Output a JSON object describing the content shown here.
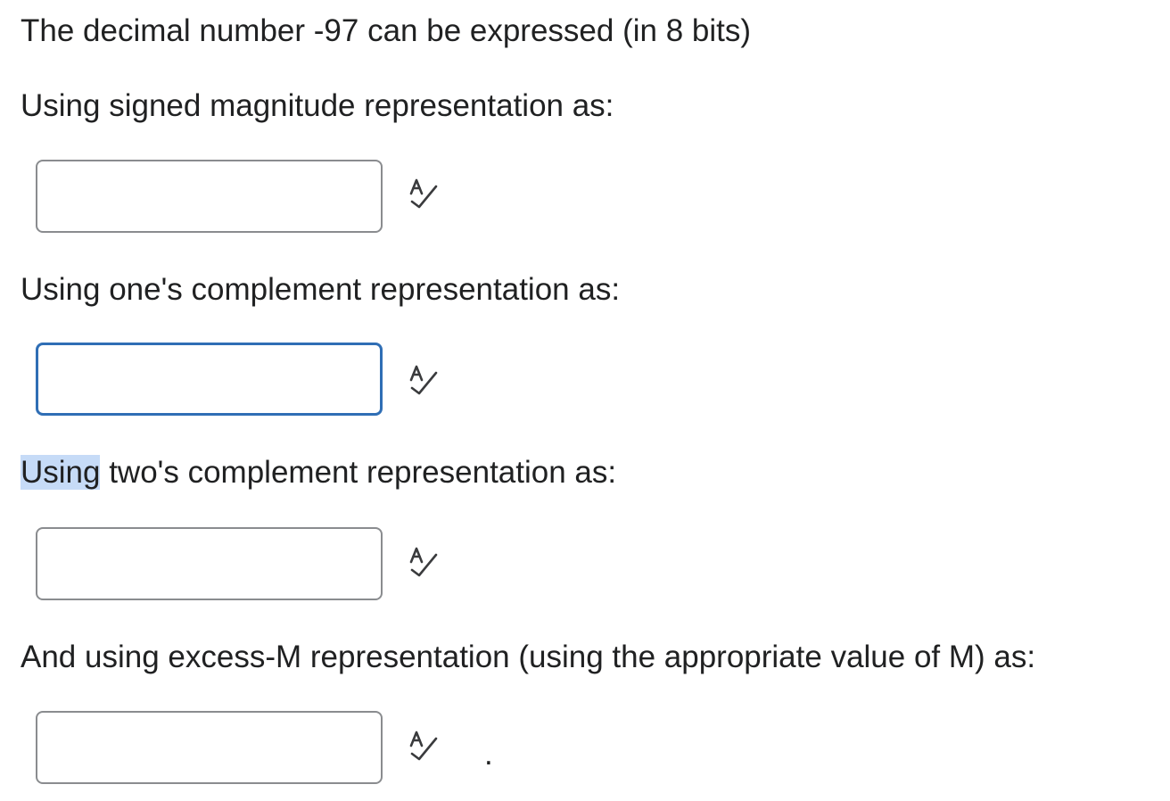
{
  "question": {
    "intro": "The decimal number -97 can be expressed (in 8 bits)",
    "prompts": [
      {
        "label": "Using signed magnitude representation as:",
        "value": ""
      },
      {
        "label": "Using one's complement representation as:",
        "value": ""
      },
      {
        "label_highlight": "Using",
        "label_rest": " two's complement representation as:",
        "value": ""
      },
      {
        "label": "And using excess-M representation (using the appropriate value of M) as:",
        "value": ""
      }
    ],
    "trailing_period": "."
  },
  "icons": {
    "spell_check": "spell-check-icon"
  },
  "colors": {
    "focus_border": "#2f6eb5",
    "selection": "#c6dbf7",
    "field_border": "#8a8c8f"
  }
}
